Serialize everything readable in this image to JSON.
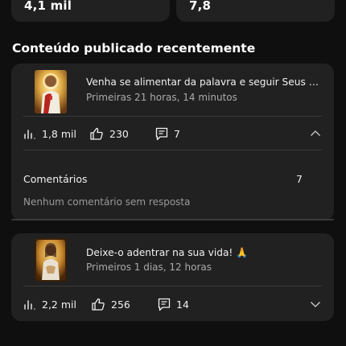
{
  "stats": {
    "left_value": "4,1 mil",
    "right_value": "7,8"
  },
  "section_title": "Conteúdo publicado recentemente",
  "videos": [
    {
      "title": "Venha se alimentar da palavra e seguir Seus ensinamentos",
      "subtitle": "Primeiras 21 horas, 14 minutos",
      "views": "1,8 mil",
      "likes": "230",
      "comments": "7",
      "expanded": true,
      "comments_panel": {
        "label": "Comentários",
        "count": "7",
        "empty_text": "Nenhum comentário sem resposta"
      }
    },
    {
      "title": "Deixe-o adentrar na sua vida! 🙏",
      "subtitle": "Primeiros 1 dias, 12 horas",
      "views": "2,2 mil",
      "likes": "256",
      "comments": "14",
      "expanded": false
    }
  ],
  "icons": {
    "views": "bar-chart-icon",
    "likes": "thumbs-up-icon",
    "comments": "comment-icon",
    "collapse": "chevron-up-icon",
    "expand": "chevron-down-icon"
  },
  "colors": {
    "background": "#0f0f0f",
    "card": "#212121",
    "text": "#f1f1f1",
    "secondary_text": "#aaaaaa"
  }
}
